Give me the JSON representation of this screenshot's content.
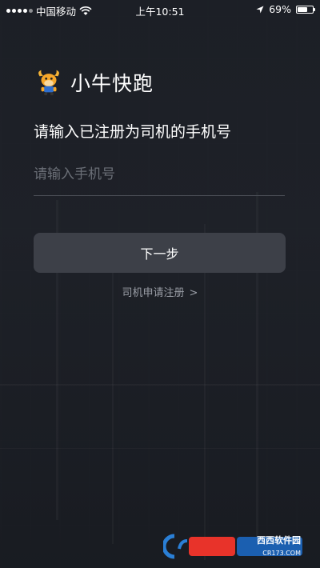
{
  "status_bar": {
    "carrier": "中国移动",
    "time": "上午10:51",
    "battery": "69%",
    "battery_level": 0.69,
    "icons": [
      "signal-icon",
      "wifi-icon",
      "location-arrow-icon",
      "battery-icon"
    ]
  },
  "brand": {
    "logo_icon": "bull-mascot-logo",
    "name": "小牛快跑"
  },
  "login": {
    "instruction": "请输入已注册为司机的手机号",
    "phone_placeholder": "请输入手机号",
    "phone_value": "",
    "next_label": "下一步",
    "register_label": "司机申请注册",
    "register_chevron": ">"
  },
  "watermark": {
    "brand_text": "西西软件园",
    "site_text": "CR173.COM"
  },
  "colors": {
    "background": "#1c1f25",
    "button": "#3d4048",
    "text": "#ffffff",
    "muted": "#9a9ea6",
    "placeholder": "#6a6e76"
  }
}
